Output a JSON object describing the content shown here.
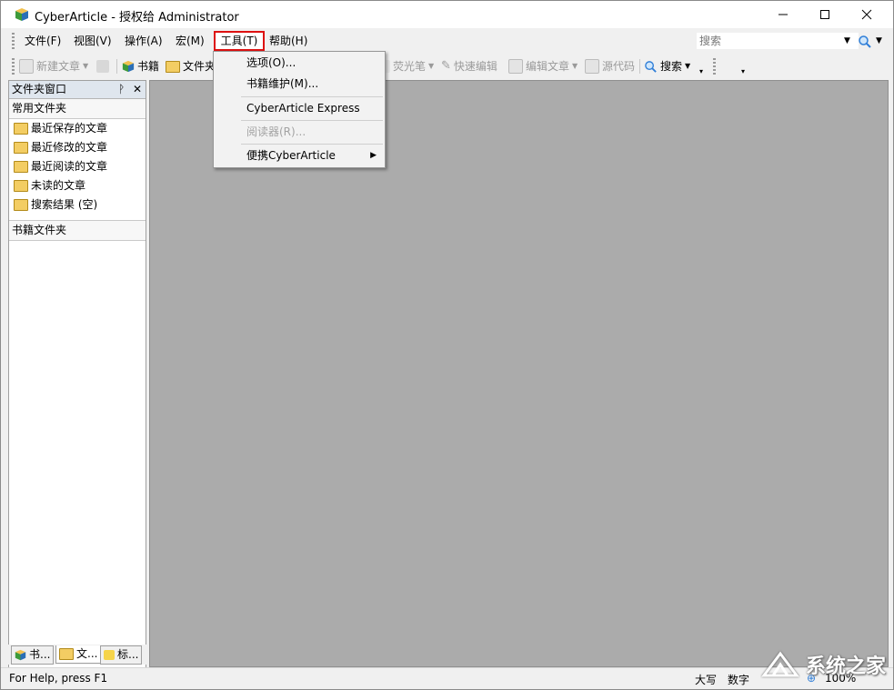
{
  "window": {
    "title": "CyberArticle - 授权给 Administrator"
  },
  "menubar": {
    "items": [
      "文件(F)",
      "视图(V)",
      "操作(A)",
      "宏(M)",
      "工具(T)",
      "帮助(H)"
    ],
    "search_placeholder": "搜索"
  },
  "toolbar": {
    "new_article": "新建文章",
    "books": "书籍",
    "folder": "文件夹",
    "highlighter": "荧光笔",
    "quick_edit": "快速编辑",
    "edit_article": "编辑文章",
    "source": "源代码",
    "search": "搜索"
  },
  "sidebar": {
    "header": "文件夹窗口",
    "section_common": "常用文件夹",
    "folders": [
      "最近保存的文章",
      "最近修改的文章",
      "最近阅读的文章",
      "未读的文章",
      "搜索结果 (空)"
    ],
    "section_books": "书籍文件夹",
    "tabs": [
      "书...",
      "文...",
      "标..."
    ]
  },
  "tools_menu": {
    "items": [
      "选项(O)...",
      "书籍维护(M)...",
      "CyberArticle Express",
      "阅读器(R)...",
      "便携CyberArticle"
    ]
  },
  "status": {
    "help": "For Help, press F1",
    "caps": "大写",
    "num": "数字",
    "zoom": "100%"
  },
  "watermark": "系统之家",
  "colors": {
    "highlight_box": "#dd1111",
    "workspace": "#ababab"
  }
}
